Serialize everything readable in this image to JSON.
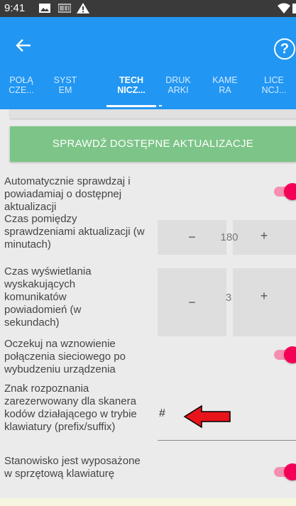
{
  "status_bar": {
    "time": "9:41",
    "icons": [
      "image-icon",
      "barcode-icon",
      "warning-icon",
      "wifi-icon",
      "battery-icon"
    ]
  },
  "app_bar": {
    "back_icon": "arrow-left-icon",
    "help_icon": "question-mark-icon",
    "help_text": "?",
    "tabs": [
      {
        "line1": "POŁĄ",
        "line2": "CZE...",
        "active": false
      },
      {
        "line1": "SYST",
        "line2": "EM",
        "active": false
      },
      {
        "line1": "TECH",
        "line2": "NICZ...",
        "active": true
      },
      {
        "line1": "DRUK",
        "line2": "ARKI",
        "active": false
      },
      {
        "line1": "KAME",
        "line2": "RA",
        "active": false
      },
      {
        "line1": "LICE",
        "line2": "NCJ...",
        "active": false
      }
    ]
  },
  "settings": {
    "update_button": "SPRAWDŹ DOSTĘPNE AKTUALIZACJE",
    "auto_check": {
      "label": "Automatycznie sprawdzaj i powiadamiaj o dostępnej aktualizacji",
      "enabled": true
    },
    "check_interval": {
      "label": "Czas pomiędzy sprawdzeniami aktualizacji (w minutach)",
      "minus": "−",
      "value": "180",
      "plus": "+"
    },
    "popup_time": {
      "label": "Czas wyświetlania wyskakujących komunikatów powiadomień (w sekundach)",
      "minus": "−",
      "value": "3",
      "plus": "+"
    },
    "wait_network": {
      "label": "Oczekuj na wznowienie połączenia sieciowego po wybudzeniu urządzenia",
      "enabled": true
    },
    "scanner_char": {
      "label": "Znak rozpoznania zarezerwowany dla skanera kodów działającego w trybie klawiatury (prefix/suffix)",
      "value": "#"
    },
    "hw_keyboard": {
      "label": "Stanowisko jest wyposażone w sprzętową klawiaturę",
      "enabled": true
    }
  },
  "colors": {
    "app_bar": "#2196f3",
    "update_button": "#7dc488",
    "switch_on": "#f50057",
    "annotation_arrow": "#e8141b"
  }
}
